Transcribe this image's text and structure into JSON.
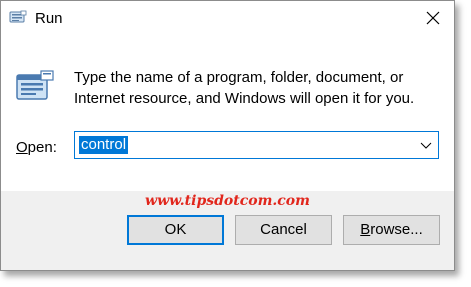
{
  "window": {
    "title": "Run",
    "icon": "run-icon",
    "close_icon": "close-icon"
  },
  "description": "Type the name of a program, folder, document, or Internet resource, and Windows will open it for you.",
  "open_field": {
    "label_underlined": "O",
    "label_rest": "pen:",
    "value": "control",
    "dropdown_icon": "chevron-down-icon"
  },
  "watermark": "www.tipsdotcom.com",
  "buttons": {
    "ok": "OK",
    "cancel": "Cancel",
    "browse_underlined": "B",
    "browse_rest": "rowse..."
  },
  "colors": {
    "accent": "#0078d7",
    "footer_bg": "#f0f0f0",
    "button_bg": "#e1e1e1",
    "watermark": "#e1261c"
  }
}
